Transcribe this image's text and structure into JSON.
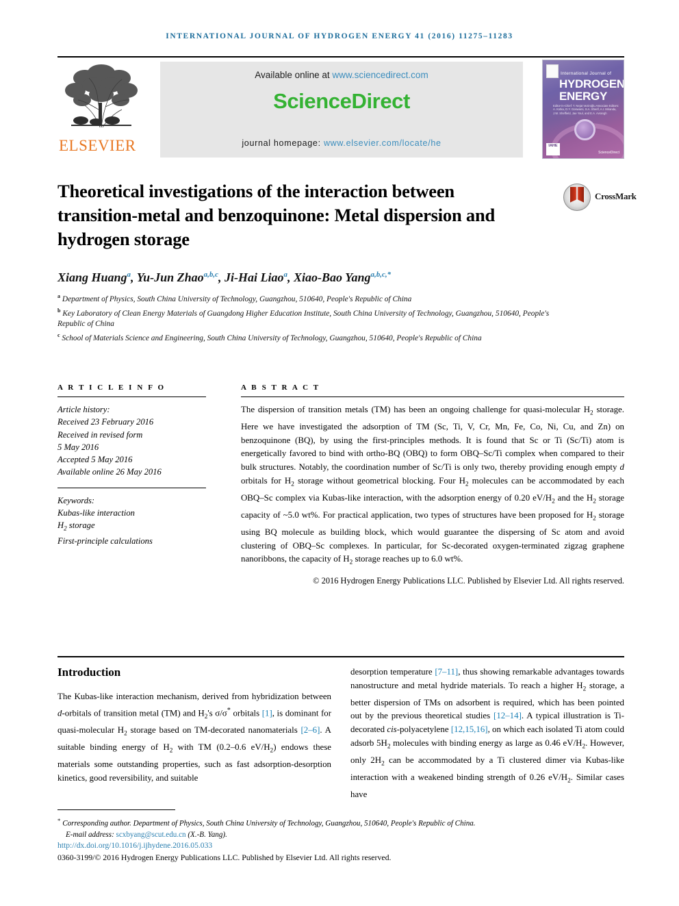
{
  "running_head": "INTERNATIONAL JOURNAL OF HYDROGEN ENERGY 41 (2016) 11275–11283",
  "banner": {
    "publisher_name": "ELSEVIER",
    "available_prefix": "Available online at ",
    "available_url": "www.sciencedirect.com",
    "sciencedirect_logo": "ScienceDirect",
    "homepage_prefix": "journal homepage: ",
    "homepage_url": "www.elsevier.com/locate/he",
    "cover": {
      "line_small": "International Journal of",
      "line_big_1": "HYDROGEN",
      "line_big_2": "ENERGY",
      "editors": "Editor-in-Chief: T. Nejat Veziroğlu    Associate Editors: A. Kotka, D.Y. Goswami, S.A. Sherif, A.I. Miranda, J.W. Sheffield, Jae Youl, and E.A. Avrangh",
      "badge": "IAHE",
      "sd_mark": "ScienceDirect"
    }
  },
  "title": "Theoretical investigations of the interaction between transition-metal and benzoquinone: Metal dispersion and hydrogen storage",
  "crossmark": {
    "label": "CrossMark"
  },
  "authors": [
    {
      "name": "Xiang Huang",
      "marks": "a"
    },
    {
      "name": "Yu-Jun Zhao",
      "marks": "a,b,c"
    },
    {
      "name": "Ji-Hai Liao",
      "marks": "a"
    },
    {
      "name": "Xiao-Bao Yang",
      "marks": "a,b,c,*"
    }
  ],
  "affiliations": [
    {
      "mark": "a",
      "text": "Department of Physics, South China University of Technology, Guangzhou, 510640, People's Republic of China"
    },
    {
      "mark": "b",
      "text": "Key Laboratory of Clean Energy Materials of Guangdong Higher Education Institute, South China University of Technology, Guangzhou, 510640, People's Republic of China"
    },
    {
      "mark": "c",
      "text": "School of Materials Science and Engineering, South China University of Technology, Guangzhou, 510640, People's Republic of China"
    }
  ],
  "article_info": {
    "heading": "A R T I C L E   I N F O",
    "history_label": "Article history:",
    "history": [
      "Received 23 February 2016",
      "Received in revised form",
      "5 May 2016",
      "Accepted 5 May 2016",
      "Available online 26 May 2016"
    ],
    "keywords_label": "Keywords:",
    "keywords": [
      "Kubas-like interaction",
      "H2 storage",
      "First-principle calculations"
    ]
  },
  "abstract": {
    "heading": "A B S T R A C T",
    "copyright": "© 2016 Hydrogen Energy Publications LLC. Published by Elsevier Ltd. All rights reserved."
  },
  "introduction": {
    "heading": "Introduction"
  },
  "footer": {
    "corresponding_prefix": "Corresponding author.",
    "corresponding_address": " Department of Physics, South China University of Technology, Guangzhou, 510640, People's Republic of China.",
    "email_label": "E-mail address: ",
    "email": "scxbyang@scut.edu.cn",
    "email_suffix": " (X.-B. Yang).",
    "doi": "http://dx.doi.org/10.1016/j.ijhydene.2016.05.033",
    "issn": "0360-3199/© 2016 Hydrogen Energy Publications LLC. Published by Elsevier Ltd. All rights reserved."
  },
  "colors": {
    "link": "#2a7fb0",
    "running_head": "#1a6b9a",
    "elsevier_orange": "#E87722",
    "sciencedirect_green": "#34b233",
    "reference_blue": "#1a7fb5"
  }
}
